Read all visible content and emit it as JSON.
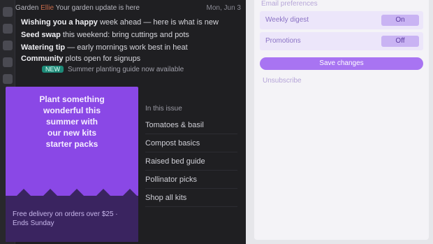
{
  "topbar": {
    "sender": "Garden",
    "sender_accent": "Ellie",
    "subject": "Your garden update is here",
    "date": "Mon, Jun 3"
  },
  "messages": [
    {
      "bold": "Wishing you a happy",
      "rest": " week ahead — here is what is new"
    },
    {
      "bold": "Seed swap",
      "rest": " this weekend: bring cuttings and pots"
    },
    {
      "bold": "Watering tip",
      "rest": " — early mornings work best in heat"
    },
    {
      "bold": "Community",
      "rest": " plots open for signups"
    }
  ],
  "tagline": {
    "chip": "NEW",
    "text": "Summer planting guide now available"
  },
  "card": {
    "lines": [
      "Plant something",
      "wonderful this",
      "summer with",
      "our new kits",
      "starter packs"
    ],
    "footer": "Free delivery on orders over $25 · Ends Sunday"
  },
  "side_notes": [
    "Tomatoes & basil",
    "Compost basics",
    "Raised bed guide",
    "Pollinator picks",
    "Shop all kits"
  ],
  "side_header": "In this issue",
  "panel": {
    "title": "Email preferences",
    "options": [
      {
        "label": "Weekly digest",
        "value": "On"
      },
      {
        "label": "Promotions",
        "value": "Off"
      }
    ],
    "button": "Save changes",
    "link": "Unsubscribe"
  },
  "colors": {
    "card": "#8a48e6",
    "button": "#a874f2",
    "chip": "#1d8a78"
  }
}
